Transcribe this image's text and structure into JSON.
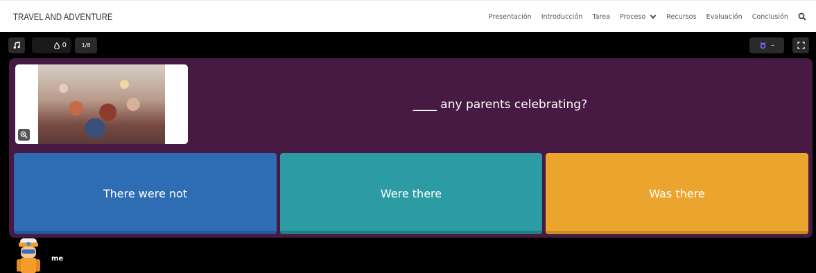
{
  "site": {
    "title": "TRAVEL AND ADVENTURE",
    "nav": [
      "Presentación",
      "Introducción",
      "Tarea",
      "Proceso",
      "Recursos",
      "Evaluación",
      "Conclusión"
    ]
  },
  "game": {
    "score": "0",
    "progress": "1/8",
    "powerup_value": "–",
    "question": "____ any parents celebrating?",
    "answers": [
      "There were not",
      "Were there",
      "Was there"
    ],
    "player_name": "me"
  },
  "colors": {
    "panel": "#461a42",
    "answer_blue": "#2e6db3",
    "answer_teal": "#2c9ba3",
    "answer_orange": "#eba52f"
  },
  "icons": [
    "music-icon",
    "drop-icon",
    "powerup-icon",
    "fullscreen-icon",
    "zoom-icon",
    "chevron-down-icon",
    "search-icon"
  ]
}
